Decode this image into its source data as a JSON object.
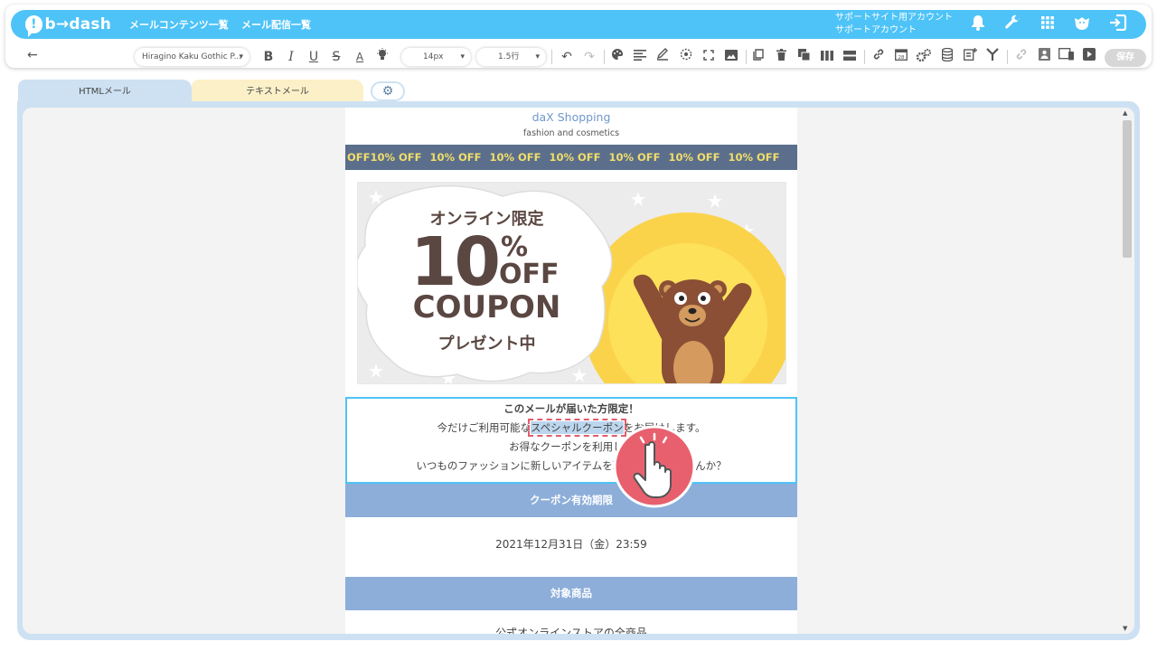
{
  "app": {
    "logo_text": "b→dash",
    "nav": [
      "メールコンテンツ一覧",
      "メール配信一覧"
    ],
    "account_line1": "サポートサイト用アカウント",
    "account_line2": "サポートアカウント",
    "icons": [
      "bell-icon",
      "wrench-icon",
      "grid-icon",
      "tiger-icon",
      "logout-icon"
    ]
  },
  "toolbar": {
    "font_select": "Hiragino Kaku Gothic P...",
    "size_select": "14px",
    "line_height_select": "1.5行",
    "save_label": "保存",
    "back_glyph": "←"
  },
  "tabs": {
    "html": "HTMLメール",
    "text": "テキストメール"
  },
  "email": {
    "shop_name": "daX Shopping",
    "shop_sub": "fashion and cosmetics",
    "banner_first": "OFF",
    "banner_item": "10% OFF",
    "hero": {
      "line1": "オンライン限定",
      "big_number": "10",
      "percent": "%",
      "off": "OFF",
      "coupon": "COUPON",
      "present": "プレゼント中"
    },
    "coupon_title": "このメールが届いた方限定！",
    "line2_before": "今だけご利用可能な",
    "line2_highlight": "スペシャルクーポン",
    "line2_after": "をお届けします。",
    "line3": "お得なクーポンを利用して",
    "line4": "いつものファッションに新しいアイテムを取り入れてみませんか？",
    "section_expiry": "クーポン有効期限",
    "expiry_value": "2021年12月31日（金）23:59",
    "section_target": "対象商品",
    "target_value": "公式オンラインストアの全商品"
  },
  "colors": {
    "brand": "#4ec3f7",
    "banner_bg": "#5b6f8c",
    "banner_text": "#f1dd6a",
    "section_bg": "#8daed9",
    "highlight_border": "#e35d6d",
    "bear_brown": "#8a4f35",
    "sun_yellow": "#fde15a"
  }
}
